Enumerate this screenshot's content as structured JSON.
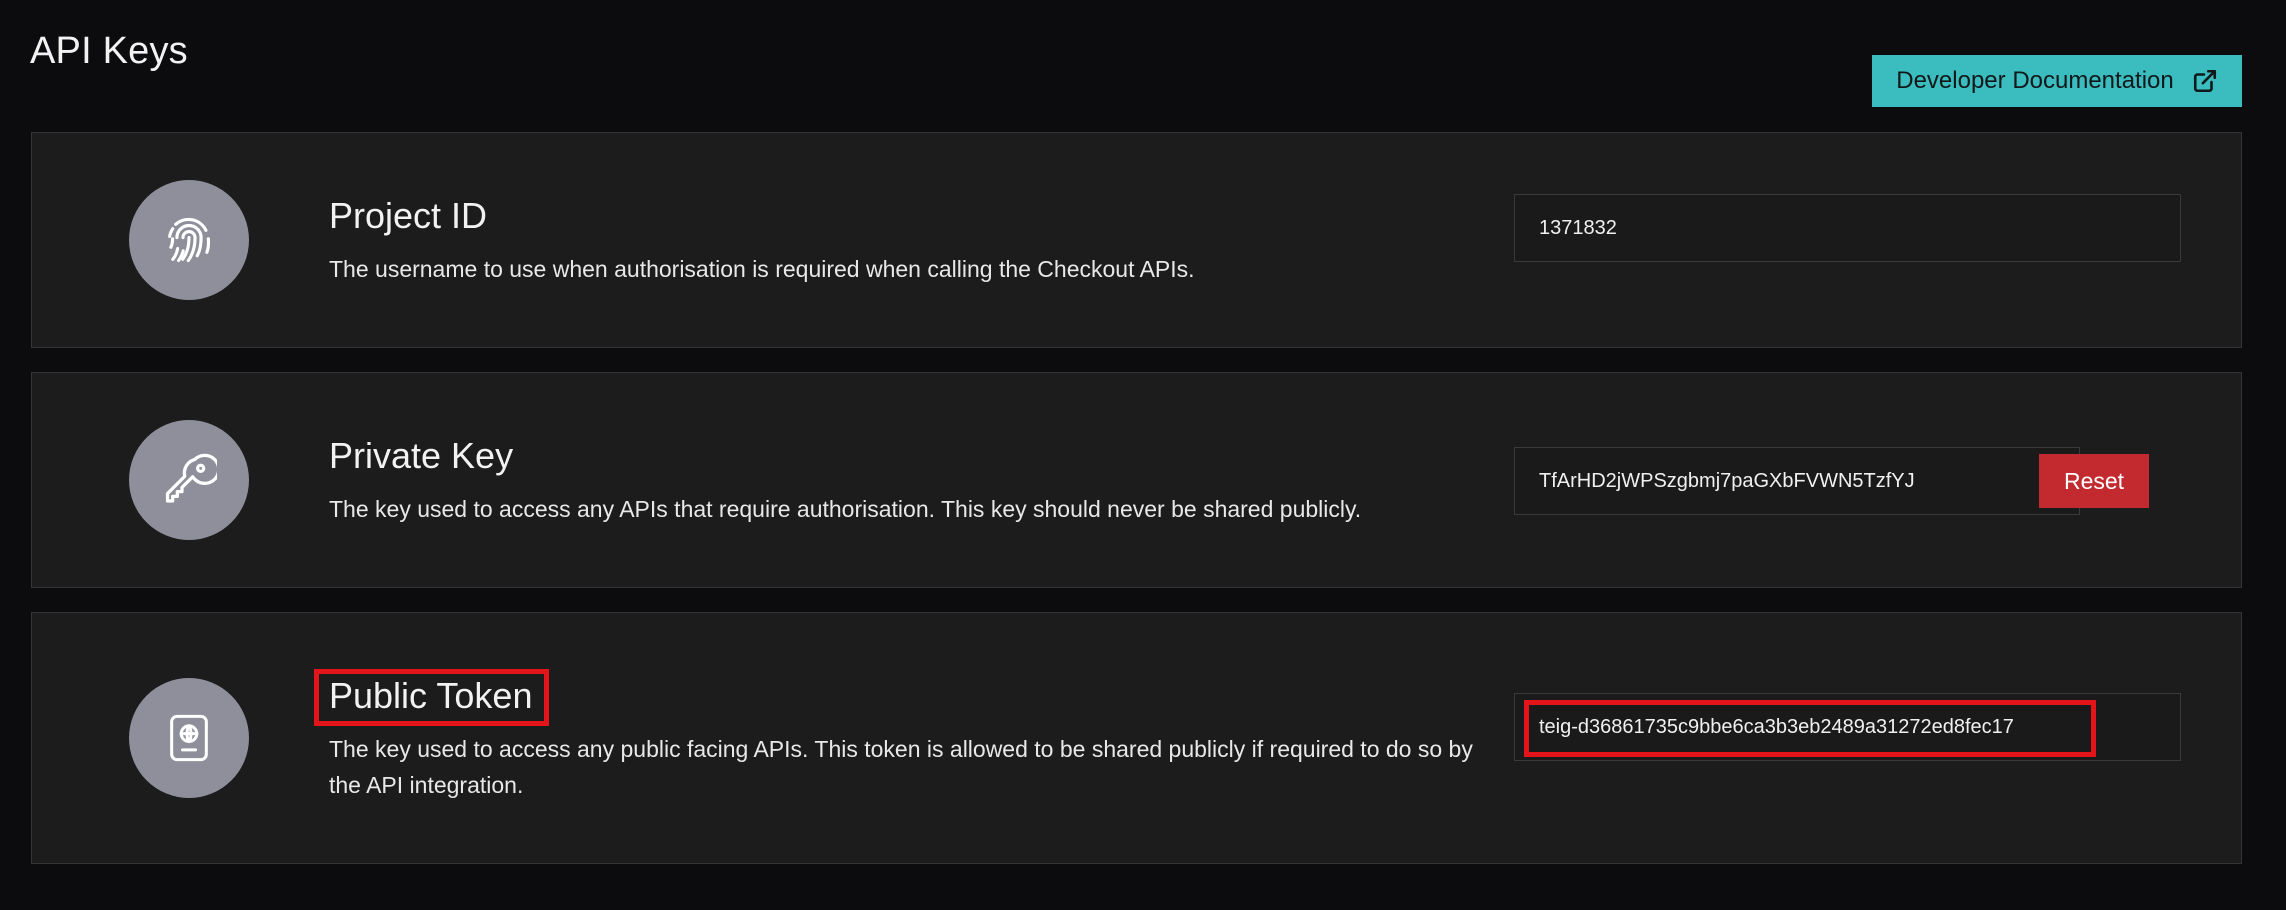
{
  "page": {
    "title": "API Keys"
  },
  "header": {
    "doc_button_label": "Developer Documentation",
    "doc_button_icon": "external-link-icon",
    "doc_button_color": "#3bbcbf"
  },
  "cards": [
    {
      "icon": "fingerprint-icon",
      "title": "Project ID",
      "description": "The username to use when authorisation is required when calling the Checkout APIs.",
      "value": "1371832"
    },
    {
      "icon": "key-icon",
      "title": "Private Key",
      "description": "The key used to access any APIs that require authorisation. This key should never be shared publicly.",
      "value": "TfArHD2jWPSzgbmj7paGXbFVWN5TzfYJ",
      "reset_label": "Reset",
      "reset_color": "#c22a2f"
    },
    {
      "icon": "passport-icon",
      "title": "Public Token",
      "description": "The key used to access any public facing APIs. This token is allowed to be shared publicly if required to do so by the API integration.",
      "value": "teig-d36861735c9bbe6ca3b3eb2489a31272ed8fec17"
    }
  ],
  "annotations": {
    "highlight_color": "#e3141a"
  }
}
